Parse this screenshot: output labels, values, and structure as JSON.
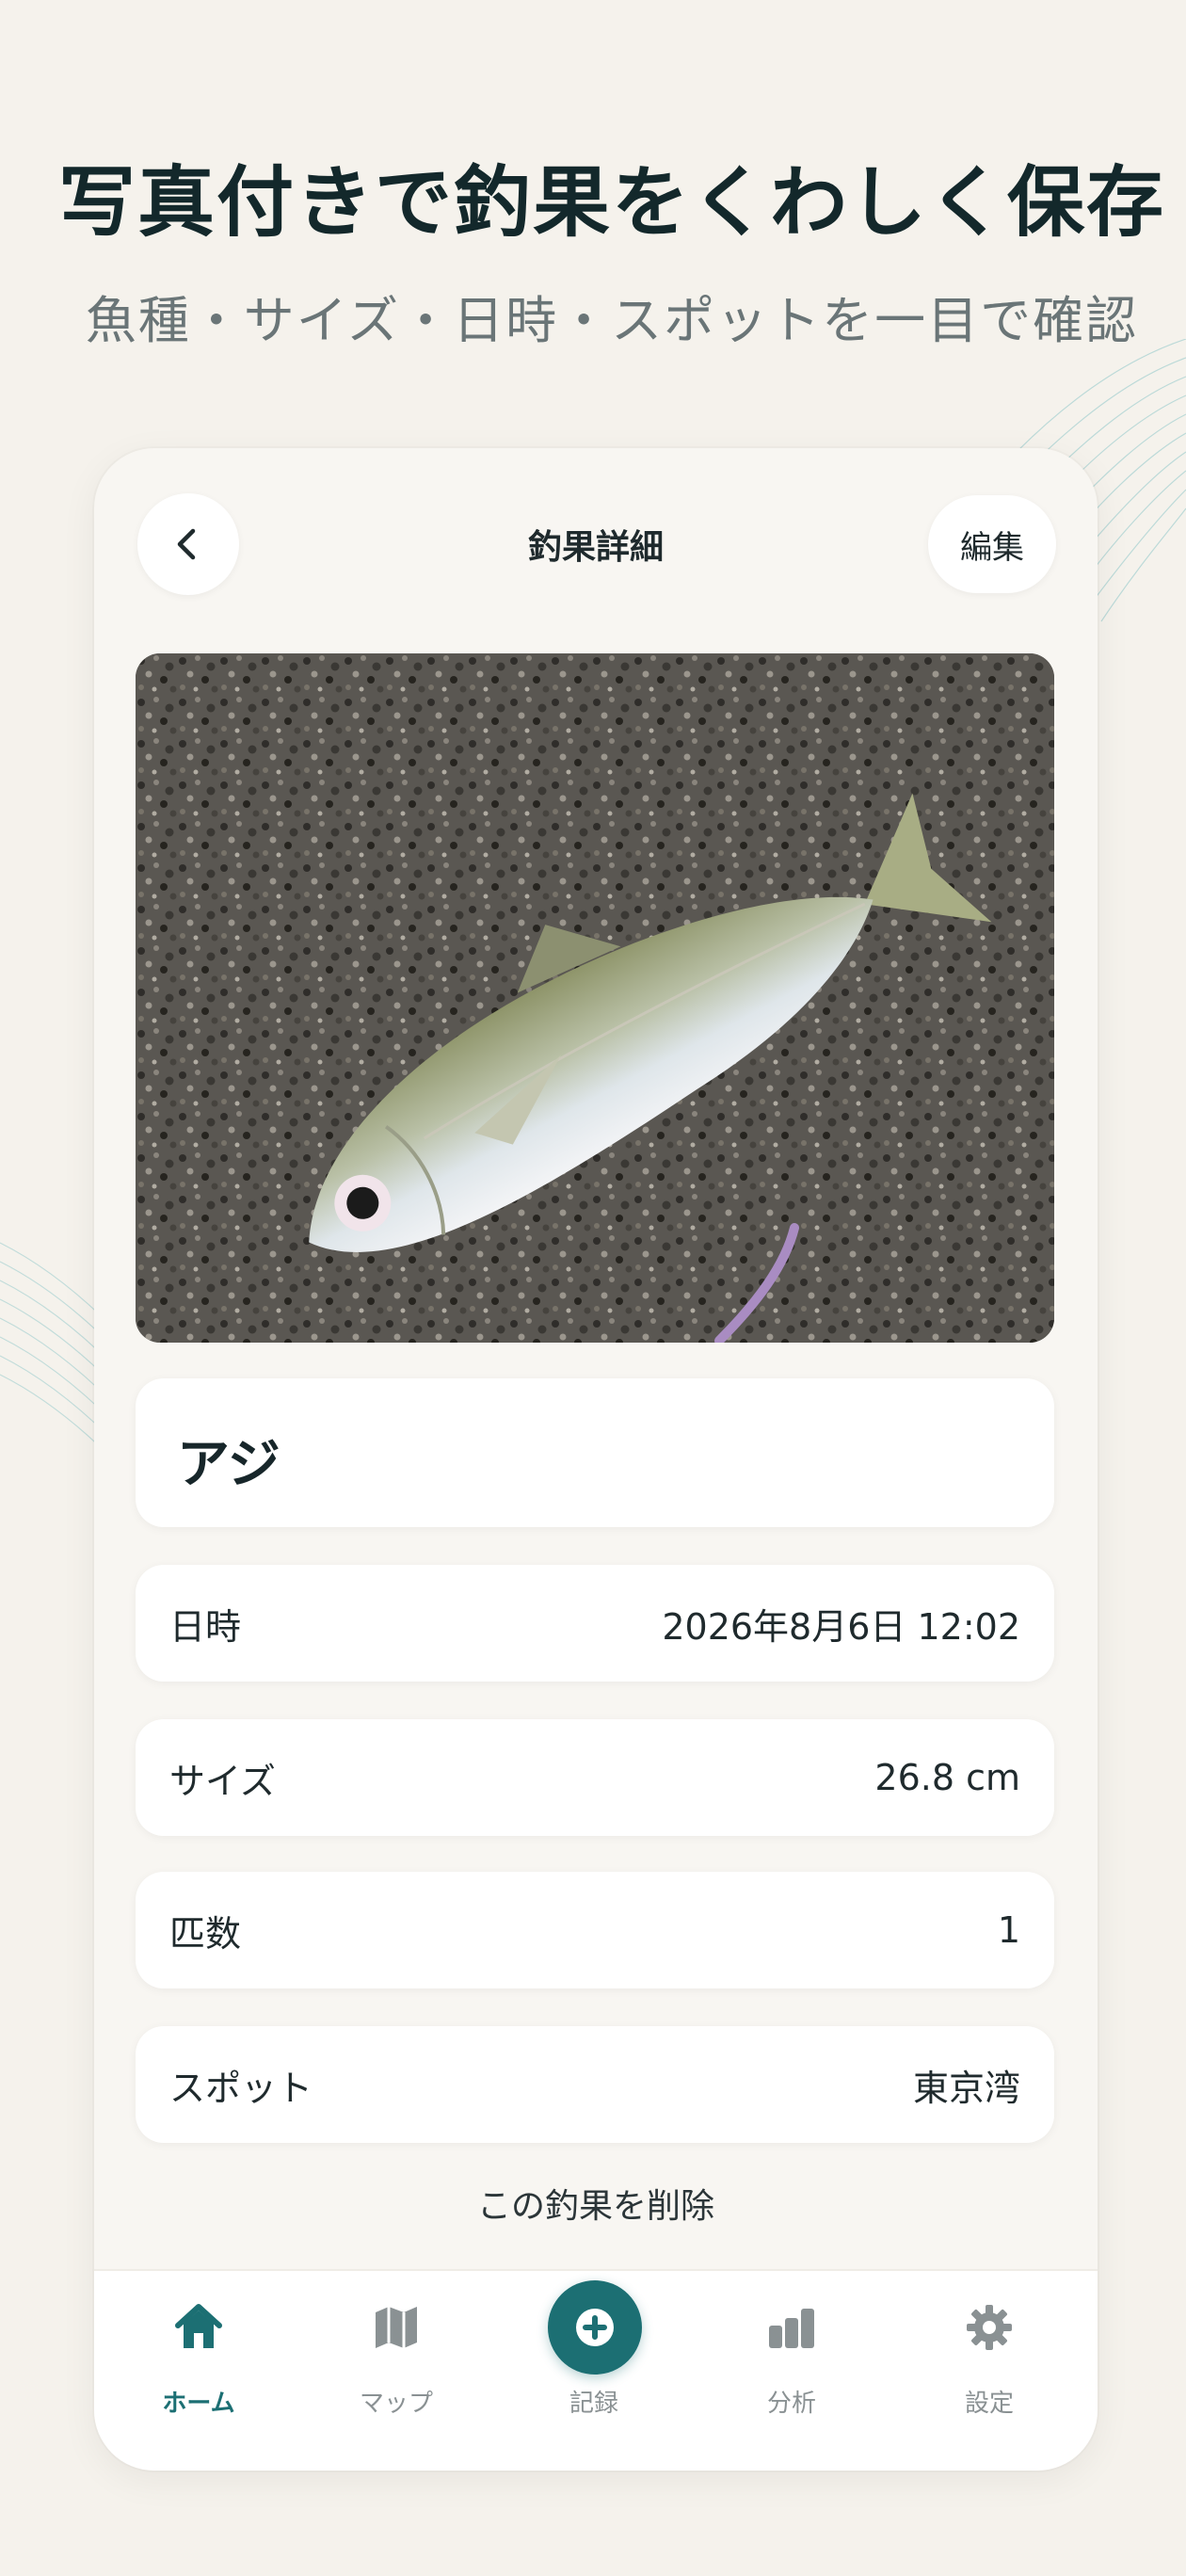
{
  "promo": {
    "headline": "写真付きで釣果をくわしく保存",
    "subhead": "魚種・サイズ・日時・スポットを一目で確認"
  },
  "header": {
    "title": "釣果詳細",
    "edit_label": "編集"
  },
  "catch": {
    "species": "アジ",
    "details": [
      {
        "label": "日時",
        "value": "2026年8月6日 12:02"
      },
      {
        "label": "サイズ",
        "value": "26.8 cm"
      },
      {
        "label": "匹数",
        "value": "1"
      },
      {
        "label": "スポット",
        "value": "東京湾"
      }
    ],
    "delete_label": "この釣果を削除"
  },
  "tabbar": {
    "items": [
      {
        "label": "ホーム",
        "icon": "home-icon",
        "active": true
      },
      {
        "label": "マップ",
        "icon": "map-icon",
        "active": false
      },
      {
        "label": "記録",
        "icon": "add-icon",
        "active": false
      },
      {
        "label": "分析",
        "icon": "bar-chart-icon",
        "active": false
      },
      {
        "label": "設定",
        "icon": "gear-icon",
        "active": false
      }
    ]
  },
  "colors": {
    "accent": "#1c6f73",
    "background": "#f5f2ec",
    "inactive": "#8a9193"
  }
}
